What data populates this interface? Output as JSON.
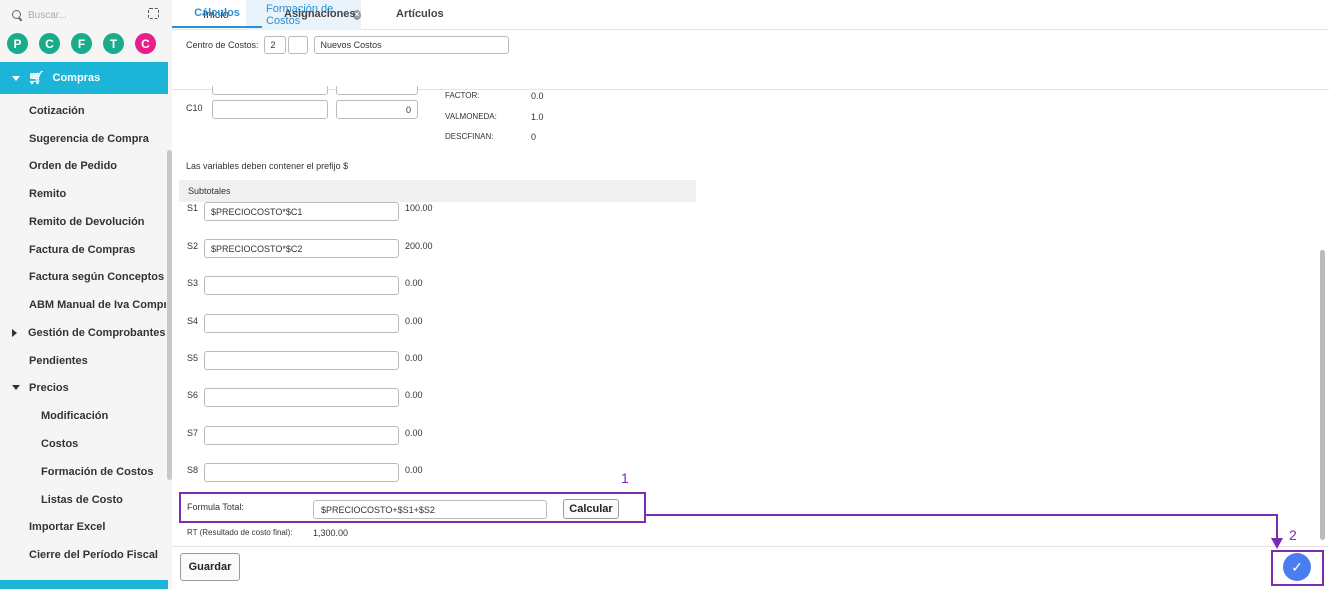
{
  "sidebar": {
    "search_placeholder": "Buscar...",
    "circles": [
      {
        "letter": "P",
        "color": "#1aab8a"
      },
      {
        "letter": "C",
        "color": "#1aab8a"
      },
      {
        "letter": "F",
        "color": "#1aab8a"
      },
      {
        "letter": "T",
        "color": "#1aab8a"
      },
      {
        "letter": "C",
        "color": "#e91e8c"
      }
    ],
    "section_title": "Compras",
    "items": [
      {
        "label": "Cotización"
      },
      {
        "label": "Sugerencia de Compra"
      },
      {
        "label": "Orden de Pedido"
      },
      {
        "label": "Remito"
      },
      {
        "label": "Remito de Devolución"
      },
      {
        "label": "Factura de Compras"
      },
      {
        "label": "Factura según Conceptos"
      },
      {
        "label": "ABM Manual de Iva Compra"
      },
      {
        "label": "Gestión de Comprobantes"
      },
      {
        "label": "Pendientes"
      },
      {
        "label": "Precios"
      },
      {
        "label": "Modificación"
      },
      {
        "label": "Costos"
      },
      {
        "label": "Formación de Costos"
      },
      {
        "label": "Listas de Costo"
      },
      {
        "label": "Importar Excel"
      },
      {
        "label": "Cierre del Período Fiscal"
      }
    ]
  },
  "tabs": {
    "home": "Inicio",
    "active": "Formación de Costos"
  },
  "centro": {
    "label": "Centro de Costos:",
    "code": "2",
    "name": "Nuevos Costos"
  },
  "subtabs": [
    "Cálculos",
    "Asignaciones",
    "Artículos"
  ],
  "c10": {
    "label": "C10",
    "value": "0"
  },
  "params": [
    {
      "name": "FACTOR:",
      "value": "0.0"
    },
    {
      "name": "VALMONEDA:",
      "value": "1.0"
    },
    {
      "name": "DESCFINAN:",
      "value": "0"
    }
  ],
  "note": "Las variables deben contener el prefijo $",
  "subtotales_title": "Subtotales",
  "subtotals": [
    {
      "label": "S1",
      "formula": "$PRECIOCOSTO*$C1",
      "result": "100.00"
    },
    {
      "label": "S2",
      "formula": "$PRECIOCOSTO*$C2",
      "result": "200.00"
    },
    {
      "label": "S3",
      "formula": "",
      "result": "0.00"
    },
    {
      "label": "S4",
      "formula": "",
      "result": "0.00"
    },
    {
      "label": "S5",
      "formula": "",
      "result": "0.00"
    },
    {
      "label": "S6",
      "formula": "",
      "result": "0.00"
    },
    {
      "label": "S7",
      "formula": "",
      "result": "0.00"
    },
    {
      "label": "S8",
      "formula": "",
      "result": "0.00"
    }
  ],
  "formula_total": {
    "label": "Formula Total:",
    "value": "$PRECIOCOSTO+$S1+$S2",
    "button": "Calcular"
  },
  "rt": {
    "label": "RT (Resultado de costo final):",
    "value": "1,300.00"
  },
  "save_button": "Guardar",
  "annotations": {
    "one": "1",
    "two": "2",
    "color": "#7c2bb3"
  },
  "colors": {
    "accent": "#1cb5d8",
    "tab_active": "#2a8fd6",
    "fab": "#4a7ef0"
  }
}
